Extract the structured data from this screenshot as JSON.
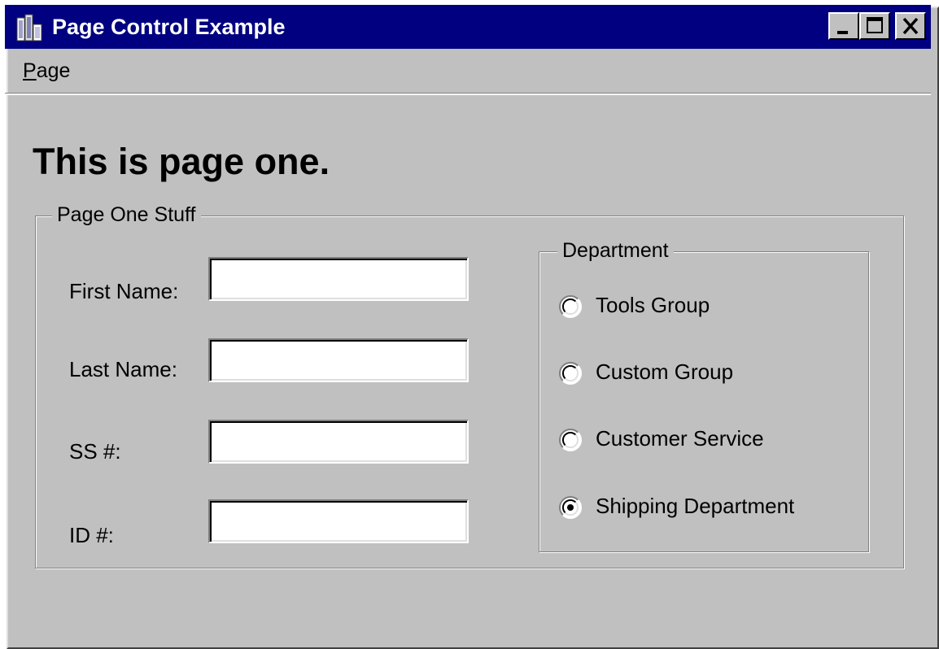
{
  "window": {
    "title": "Page Control Example",
    "app_icon": "application-icon",
    "controls": {
      "minimize_icon": "minimize-icon",
      "maximize_icon": "maximize-icon",
      "close_icon": "close-icon"
    },
    "titlebar_color": "#000080",
    "face_color": "#c0c0c0"
  },
  "menu": {
    "items": [
      {
        "accelerator": "P",
        "rest": "age"
      }
    ]
  },
  "page": {
    "heading": "This is page one."
  },
  "group_main": {
    "caption": "Page One Stuff",
    "fields": [
      {
        "label": "First Name:",
        "value": ""
      },
      {
        "label": "Last Name:",
        "value": ""
      },
      {
        "label": "SS #:",
        "value": ""
      },
      {
        "label": "ID #:",
        "value": ""
      }
    ]
  },
  "group_department": {
    "caption": "Department",
    "options": [
      {
        "label": "Tools Group",
        "selected": false
      },
      {
        "label": "Custom Group",
        "selected": false
      },
      {
        "label": "Customer Service",
        "selected": false
      },
      {
        "label": "Shipping Department",
        "selected": true
      }
    ]
  }
}
